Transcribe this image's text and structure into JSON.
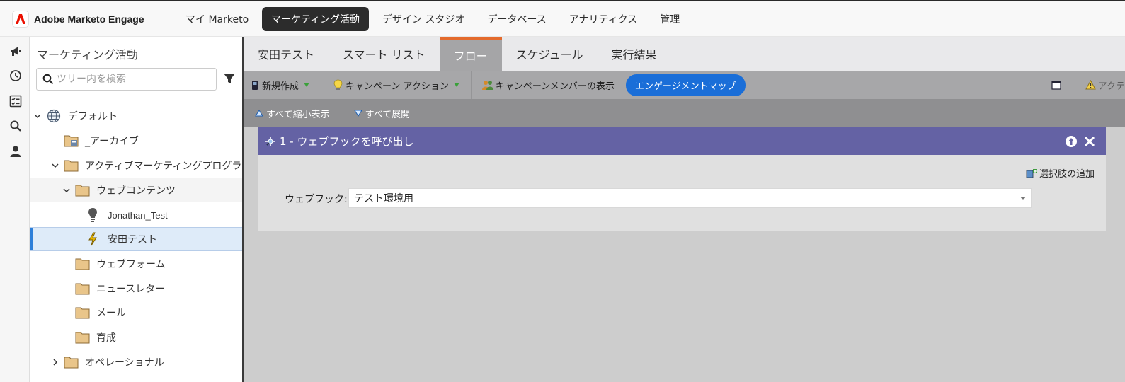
{
  "app": {
    "brand_name": "Adobe Marketo Engage",
    "nav": [
      {
        "label": "マイ Marketo",
        "active": false
      },
      {
        "label": "マーケティング活動",
        "active": true
      },
      {
        "label": "デザイン スタジオ",
        "active": false
      },
      {
        "label": "データベース",
        "active": false
      },
      {
        "label": "アナリティクス",
        "active": false
      },
      {
        "label": "管理",
        "active": false
      }
    ]
  },
  "rail": {
    "icons": [
      "megaphone-icon",
      "history-icon",
      "checklist-icon",
      "search-icon",
      "person-icon"
    ]
  },
  "tree": {
    "title": "マーケティング活動",
    "search_placeholder": "ツリー内を検索",
    "items": [
      {
        "label": "デフォルト",
        "icon": "globe-icon",
        "expanded": true
      },
      {
        "label": "_アーカイブ",
        "icon": "archive-folder-icon"
      },
      {
        "label": "アクティブマーケティングプログラム",
        "icon": "folder-icon",
        "expanded": true
      },
      {
        "label": "ウェブコンテンツ",
        "icon": "folder-icon",
        "expanded": true
      },
      {
        "label": "Jonathan_Test",
        "icon": "lightbulb-icon"
      },
      {
        "label": "安田テスト",
        "icon": "lightning-icon",
        "selected": true
      },
      {
        "label": "ウェブフォーム",
        "icon": "folder-icon"
      },
      {
        "label": "ニュースレター",
        "icon": "folder-icon"
      },
      {
        "label": "メール",
        "icon": "folder-icon"
      },
      {
        "label": "育成",
        "icon": "folder-icon"
      },
      {
        "label": "オペレーショナル",
        "icon": "folder-icon",
        "expanded": false
      }
    ]
  },
  "tabs": [
    {
      "label": "安田テスト",
      "active": false
    },
    {
      "label": "スマート リスト",
      "active": false
    },
    {
      "label": "フロー",
      "active": true
    },
    {
      "label": "スケジュール",
      "active": false
    },
    {
      "label": "実行結果",
      "active": false
    }
  ],
  "toolbar": {
    "new_label": "新規作成",
    "campaign_actions_label": "キャンペーン アクション",
    "show_members_label": "キャンペーンメンバーの表示",
    "engagement_map_label": "エンゲージメントマップ",
    "action_cut_label": "アクテ"
  },
  "subbar": {
    "collapse_all": "すべて縮小表示",
    "expand_all": "すべて展開"
  },
  "flow_step": {
    "title": "1 - ウェブフックを呼び出し",
    "add_choice_label": "選択肢の追加",
    "field_label": "ウェブフック:",
    "field_value": "テスト環境用"
  },
  "colors": {
    "active_tab_accent": "#e36a2c",
    "step_header": "#6462a4",
    "engagement_pill": "#1a6ed8",
    "selected_row": "#deebf9",
    "brand_red": "#eb1000"
  }
}
